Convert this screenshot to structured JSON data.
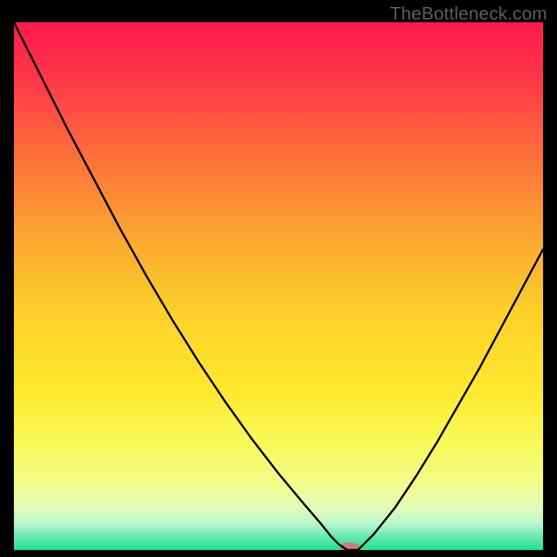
{
  "watermark": "TheBottleneck.com",
  "chart_data": {
    "type": "line",
    "title": "",
    "xlabel": "",
    "ylabel": "",
    "xlim": [
      0,
      100
    ],
    "ylim": [
      0,
      100
    ],
    "grid": false,
    "legend": false,
    "gradient_background": {
      "stops": [
        {
          "offset": 0.0,
          "color": "#ff1a4b"
        },
        {
          "offset": 0.1,
          "color": "#ff344a"
        },
        {
          "offset": 0.25,
          "color": "#fd6e3a"
        },
        {
          "offset": 0.4,
          "color": "#fba431"
        },
        {
          "offset": 0.55,
          "color": "#fdd02a"
        },
        {
          "offset": 0.7,
          "color": "#ffe92f"
        },
        {
          "offset": 0.8,
          "color": "#f8fa59"
        },
        {
          "offset": 0.88,
          "color": "#f2fc91"
        },
        {
          "offset": 0.92,
          "color": "#e2fbb9"
        },
        {
          "offset": 0.95,
          "color": "#bdf6cd"
        },
        {
          "offset": 0.975,
          "color": "#64e9b2"
        },
        {
          "offset": 1.0,
          "color": "#21e28f"
        }
      ]
    },
    "series": [
      {
        "name": "bottleneck-curve",
        "color": "#000000",
        "x": [
          0.0,
          2.0,
          5.0,
          10.0,
          15.0,
          20.0,
          25.0,
          30.0,
          35.0,
          40.0,
          45.0,
          50.0,
          55.0,
          58.0,
          60.0,
          61.5,
          63.0,
          65.0,
          68.0,
          72.0,
          76.0,
          80.0,
          84.0,
          88.0,
          92.0,
          96.0,
          100.0
        ],
        "y": [
          100.0,
          96.0,
          90.0,
          80.0,
          70.5,
          61.0,
          52.0,
          43.5,
          35.5,
          28.0,
          21.0,
          14.5,
          8.5,
          5.0,
          2.5,
          1.0,
          0.0,
          0.0,
          3.0,
          8.0,
          14.0,
          20.5,
          27.5,
          34.5,
          42.0,
          49.5,
          57.0
        ]
      }
    ],
    "annotations": [
      {
        "name": "minimum-marker",
        "shape": "rounded-rect",
        "x": 63.5,
        "y": 0.0,
        "width_x_units": 3.5,
        "height_y_units": 2.0,
        "fill": "#cf7a78"
      }
    ]
  }
}
